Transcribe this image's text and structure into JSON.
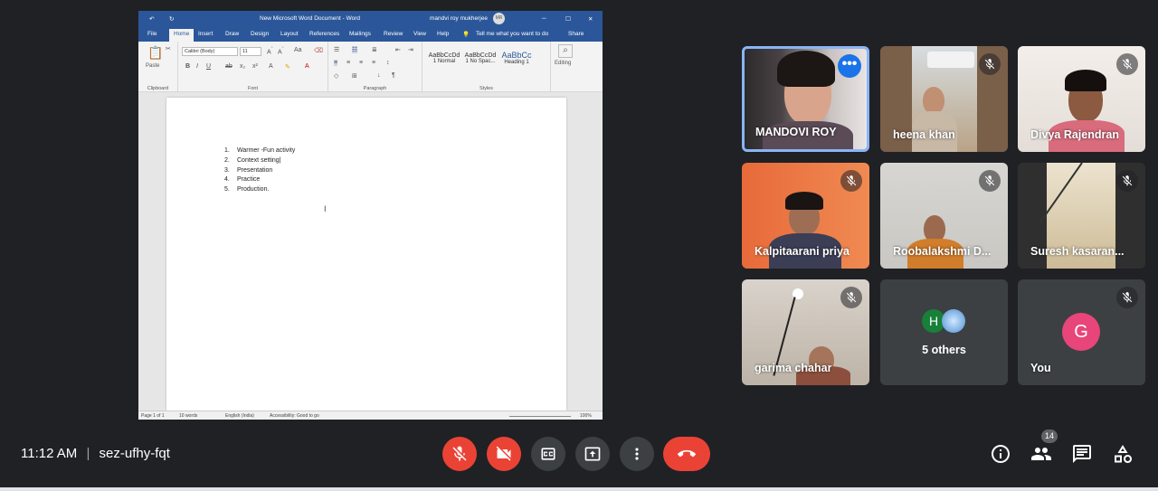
{
  "word": {
    "title": "New Microsoft Word Document - Word",
    "user": "mandvi roy mukherjee",
    "user_initials": "MR",
    "tabs": [
      "File",
      "Home",
      "Insert",
      "Draw",
      "Design",
      "Layout",
      "References",
      "Mailings",
      "Review",
      "View",
      "Help"
    ],
    "tell_me": "Tell me what you want to do",
    "share": "Share",
    "ribbon": {
      "paste": "Paste",
      "clipboard": "Clipboard",
      "font_name": "Calibri (Body)",
      "font_size": "11",
      "font": "Font",
      "paragraph": "Paragraph",
      "styles": "Styles",
      "editing": "Editing",
      "style_normal": "1 Normal",
      "style_nospace": "1 No Spac...",
      "style_heading": "Heading 1",
      "style_sample": "AaBbCcDd",
      "style_heading_sample": "AaBbCc"
    },
    "list": [
      "Warmer -Fun activity",
      "Context setting",
      "Presentation",
      "Practice",
      "Production."
    ],
    "status": {
      "page": "Page 1 of 1",
      "words": "10 words",
      "lang": "English (India)",
      "access": "Accessibility: Good to go",
      "zoom": "100%"
    }
  },
  "participants": [
    {
      "name": "MANDOVI ROY"
    },
    {
      "name": "heena khan"
    },
    {
      "name": "Divya Rajendran"
    },
    {
      "name": "Kalpitaarani priya"
    },
    {
      "name": "Roobalakshmi D..."
    },
    {
      "name": "Suresh kasaran..."
    },
    {
      "name": "garima chahar"
    },
    {
      "name": "5 others",
      "avatar": "H"
    },
    {
      "name": "You",
      "avatar": "G"
    }
  ],
  "meeting": {
    "time": "11:12 AM",
    "separator": "|",
    "code": "sez-ufhy-fqt",
    "participant_count": "14"
  },
  "colors": {
    "red": "#ea4335",
    "dark": "#202124",
    "tile": "#3c4043",
    "word_blue": "#2b579a",
    "avatar_g": "#e8457a",
    "avatar_h": "#188038"
  }
}
